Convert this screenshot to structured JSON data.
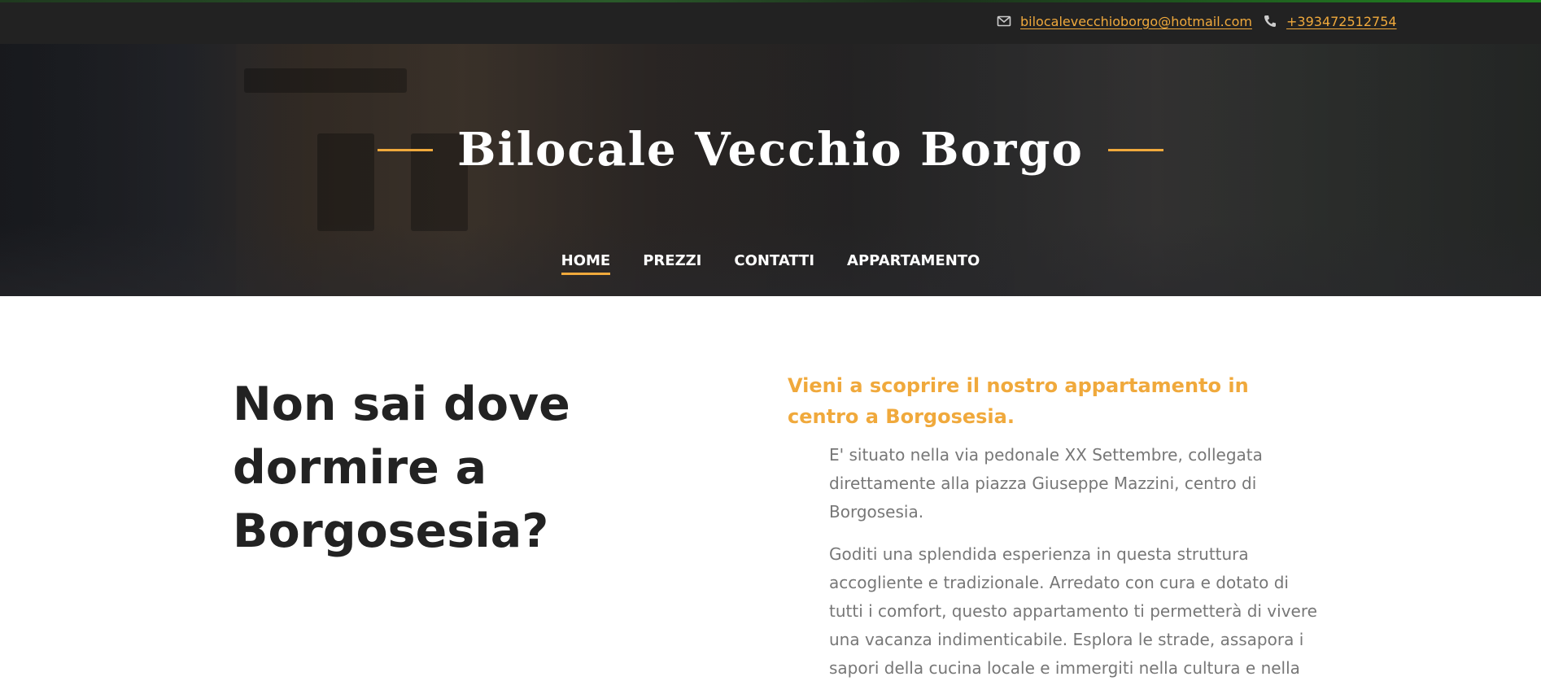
{
  "topbar": {
    "email": "bilocalevecchioborgo@hotmail.com",
    "phone": "+393472512754",
    "email_icon": "envelope-icon",
    "phone_icon": "phone-icon"
  },
  "hero": {
    "title": "Bilocale Vecchio Borgo"
  },
  "nav": {
    "items": [
      {
        "label": "HOME",
        "active": true
      },
      {
        "label": "PREZZI",
        "active": false
      },
      {
        "label": "CONTATTI",
        "active": false
      },
      {
        "label": "APPARTAMENTO",
        "active": false
      }
    ]
  },
  "main": {
    "heading": "Non sai dove dormire a Borgosesia?",
    "subheading": "Vieni a scoprire il nostro appartamento in centro a Borgosesia.",
    "paragraphs": [
      "E' situato nella via pedonale XX Settembre, collegata direttamente alla piazza Giuseppe Mazzini, centro di Borgosesia.",
      "Goditi una splendida esperienza in questa struttura accogliente e tradizionale. Arredato con cura e dotato di tutti i comfort, questo appartamento ti permetterà di vivere una vacanza indimenticabile. Esplora le strade, assapora i sapori della cucina locale e immergiti nella cultura e nella"
    ]
  },
  "colors": {
    "accent": "#f0a93c",
    "topbar_bg": "#222222",
    "heading": "#222222",
    "body_text": "#777777"
  }
}
